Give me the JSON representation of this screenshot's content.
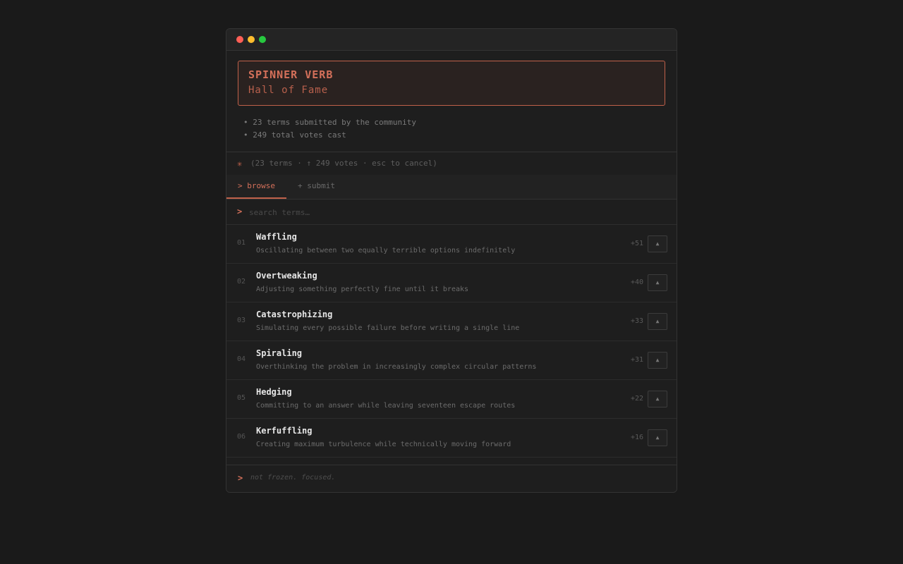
{
  "header": {
    "title": "SPINNER VERB",
    "subtitle": "Hall of Fame"
  },
  "stats": [
    "• 23 terms submitted by the community",
    "• 249 total votes cast"
  ],
  "statusline": {
    "icon": "✳",
    "text": "(23 terms · ↑ 249 votes · esc to cancel)"
  },
  "tabs": {
    "browse": "> browse",
    "submit": "+ submit"
  },
  "search": {
    "prompt": ">",
    "placeholder": "search terms…"
  },
  "terms": [
    {
      "rank": "01",
      "term": "Waffling",
      "definition": "Oscillating between two equally terrible options indefinitely",
      "votes": "+51"
    },
    {
      "rank": "02",
      "term": "Overtweaking",
      "definition": "Adjusting something perfectly fine until it breaks",
      "votes": "+40"
    },
    {
      "rank": "03",
      "term": "Catastrophizing",
      "definition": "Simulating every possible failure before writing a single line",
      "votes": "+33"
    },
    {
      "rank": "04",
      "term": "Spiraling",
      "definition": "Overthinking the problem in increasingly complex circular patterns",
      "votes": "+31"
    },
    {
      "rank": "05",
      "term": "Hedging",
      "definition": "Committing to an answer while leaving seventeen escape routes",
      "votes": "+22"
    },
    {
      "rank": "06",
      "term": "Kerfuffling",
      "definition": "Creating maximum turbulence while technically moving forward",
      "votes": "+16"
    }
  ],
  "upvote_label": "▲",
  "footer": {
    "prompt": ">",
    "tagline": "not frozen. focused."
  }
}
